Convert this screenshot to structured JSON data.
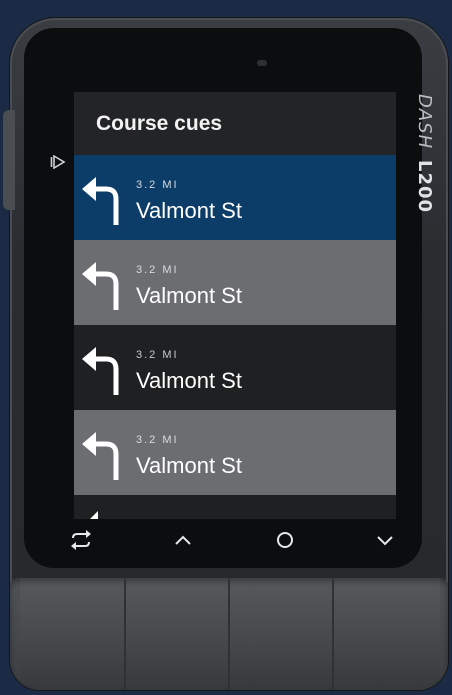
{
  "device": {
    "brand_line1": "DASH",
    "brand_line2": "L200"
  },
  "screen": {
    "title": "Course cues",
    "cues": [
      {
        "distance": "3.2 MI",
        "street": "Valmont St",
        "turn": "left-turn-icon",
        "state": "selected"
      },
      {
        "distance": "3.2 MI",
        "street": "Valmont St",
        "turn": "left-turn-icon",
        "state": "light"
      },
      {
        "distance": "3.2 MI",
        "street": "Valmont St",
        "turn": "left-turn-icon",
        "state": "dark"
      },
      {
        "distance": "3.2 MI",
        "street": "Valmont St",
        "turn": "left-turn-icon",
        "state": "light"
      }
    ]
  },
  "nav": {
    "buttons": [
      "loop-icon",
      "chevron-up-icon",
      "circle-icon",
      "chevron-down-icon"
    ]
  },
  "colors": {
    "selected_row": "#0b3d68",
    "light_row": "#6b6d70",
    "dark_row": "#1f2022",
    "background": "#1b2a45"
  }
}
